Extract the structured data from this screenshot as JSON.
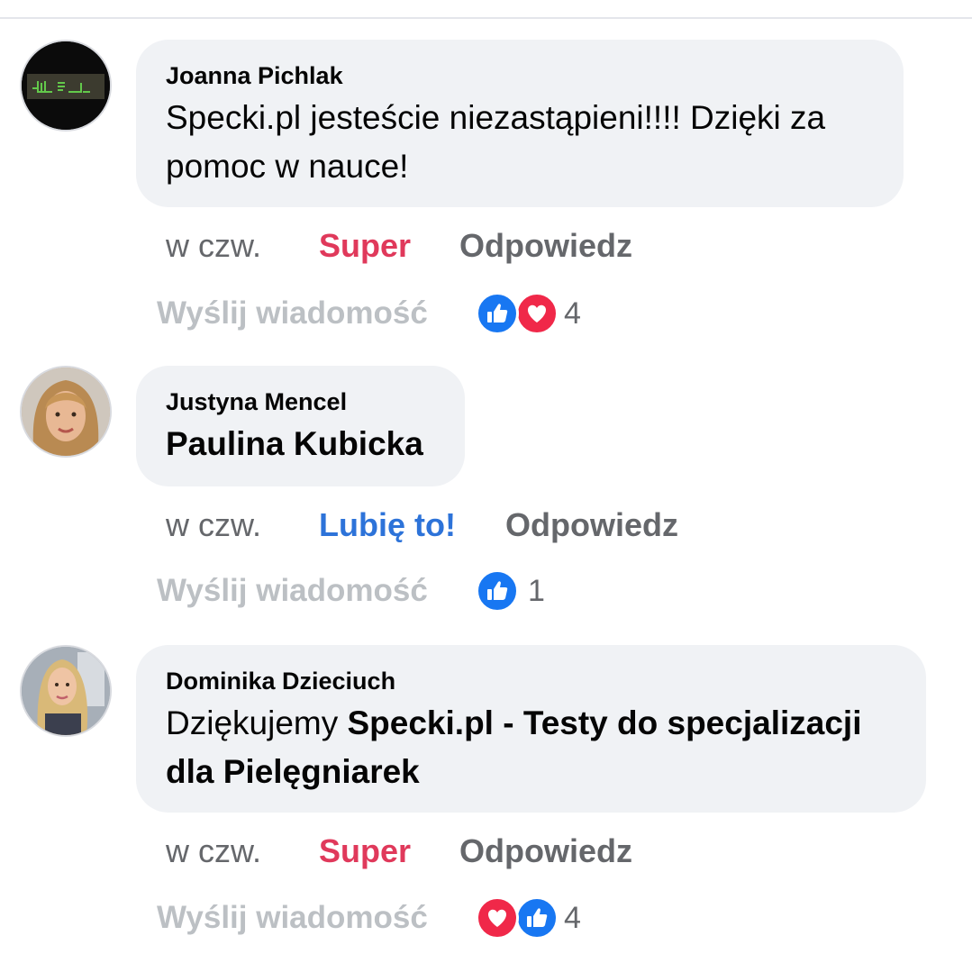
{
  "comments": [
    {
      "author": "Joanna Pichlak",
      "text": "Specki.pl jesteście niezastąpieni!!!! Dzięki za pomoc w nauce!",
      "time": "w czw.",
      "reaction_label": "Super",
      "reply_label": "Odpowiedz",
      "send_label": "Wyślij wiadomość",
      "reaction_icons": [
        "like-icon",
        "love-icon"
      ],
      "reaction_count": "4"
    },
    {
      "author": "Justyna Mencel",
      "text": "Paulina Kubicka",
      "time": "w czw.",
      "reaction_label": "Lubię to!",
      "reply_label": "Odpowiedz",
      "send_label": "Wyślij wiadomość",
      "reaction_icons": [
        "like-icon"
      ],
      "reaction_count": "1"
    },
    {
      "author": "Dominika Dzieciuch",
      "text_prefix": "Dziękujemy ",
      "text_mention": "Specki.pl - Testy do specjalizacji dla Pielęgniarek",
      "time": "w czw.",
      "reaction_label": "Super",
      "reply_label": "Odpowiedz",
      "send_label": "Wyślij wiadomość",
      "reaction_icons": [
        "love-icon",
        "like-icon"
      ],
      "reaction_count": "4"
    }
  ],
  "colors": {
    "bubble": "#f0f2f5",
    "love_reaction_text": "#e0395b",
    "like_reaction_text": "#2d73d9",
    "secondary_text": "#65676b",
    "muted_text": "#bcc0c4",
    "like_icon": "#1877f2",
    "love_icon": "#f02849"
  }
}
